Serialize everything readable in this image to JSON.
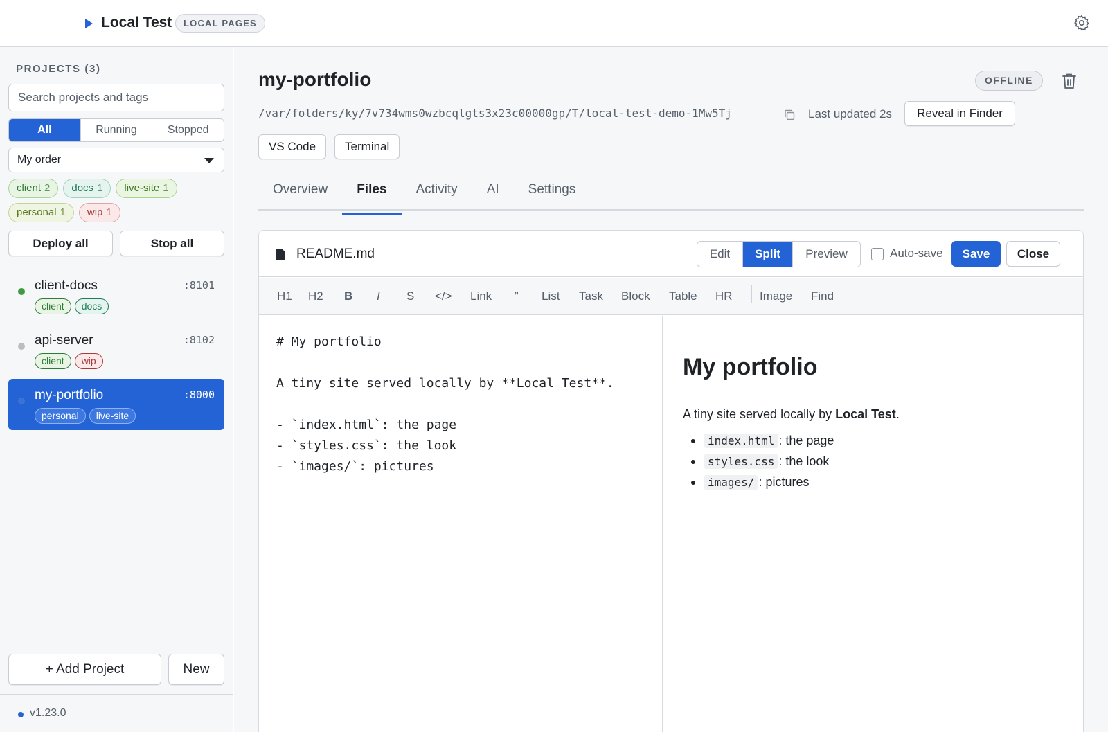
{
  "colors": {
    "accent": "#2463d6",
    "running": "#3f9a43",
    "stopped": "#b9bec4"
  },
  "topbar": {
    "title": "Local Test",
    "badge": "LOCAL PAGES"
  },
  "sidebar": {
    "heading": "PROJECTS (3)",
    "search_placeholder": "Search projects and tags",
    "filters": [
      "All",
      "Running",
      "Stopped"
    ],
    "sort": "My order",
    "tags": [
      {
        "name": "client",
        "count": "2"
      },
      {
        "name": "docs",
        "count": "1"
      },
      {
        "name": "live-site",
        "count": "1"
      },
      {
        "name": "personal",
        "count": "1"
      },
      {
        "name": "wip",
        "count": "1"
      }
    ],
    "deploy_all": "Deploy all",
    "stop_all": "Stop all",
    "projects": [
      {
        "name": "client-docs",
        "port": ":8101",
        "status": "running",
        "tags": [
          "client",
          "docs"
        ]
      },
      {
        "name": "api-server",
        "port": ":8102",
        "status": "stopped",
        "tags": [
          "client",
          "wip"
        ]
      },
      {
        "name": "my-portfolio",
        "port": ":8000",
        "status": "stopped",
        "tags": [
          "personal",
          "live-site"
        ]
      }
    ],
    "add_project": "+ Add Project",
    "new": "New",
    "version": "v1.23.0"
  },
  "main": {
    "title": "my-portfolio",
    "status": "OFFLINE",
    "path": "/var/folders/ky/7v734wms0wzbcqlgts3x23c00000gp/T/local-test-demo-1Mw5Tj",
    "updated": "Last updated 2s",
    "reveal": "Reveal in Finder",
    "open_vscode": "VS Code",
    "open_terminal": "Terminal",
    "tabs": [
      "Overview",
      "Files",
      "Activity",
      "AI",
      "Settings"
    ],
    "editor": {
      "filename": "README.md",
      "modes": [
        "Edit",
        "Split",
        "Preview"
      ],
      "autosave": "Auto-save",
      "save": "Save",
      "close": "Close",
      "toolbar": [
        "H1",
        "H2",
        "B",
        "I",
        "S",
        "</>",
        "Link",
        "”",
        "List",
        "Task",
        "Block",
        "Table",
        "HR",
        "Image",
        "Find"
      ],
      "source": [
        "# My portfolio",
        "",
        "A tiny site served locally by **Local Test**.",
        "",
        "- `index.html`: the page",
        "- `styles.css`: the look",
        "- `images/`: pictures"
      ],
      "preview": {
        "h1": "My portfolio",
        "p_before": "A tiny site served locally by ",
        "p_bold": "Local Test",
        "p_after": ".",
        "items": [
          {
            "code": "index.html",
            "text": ": the page"
          },
          {
            "code": "styles.css",
            "text": ": the look"
          },
          {
            "code": "images/",
            "text": ": pictures"
          }
        ]
      }
    }
  }
}
